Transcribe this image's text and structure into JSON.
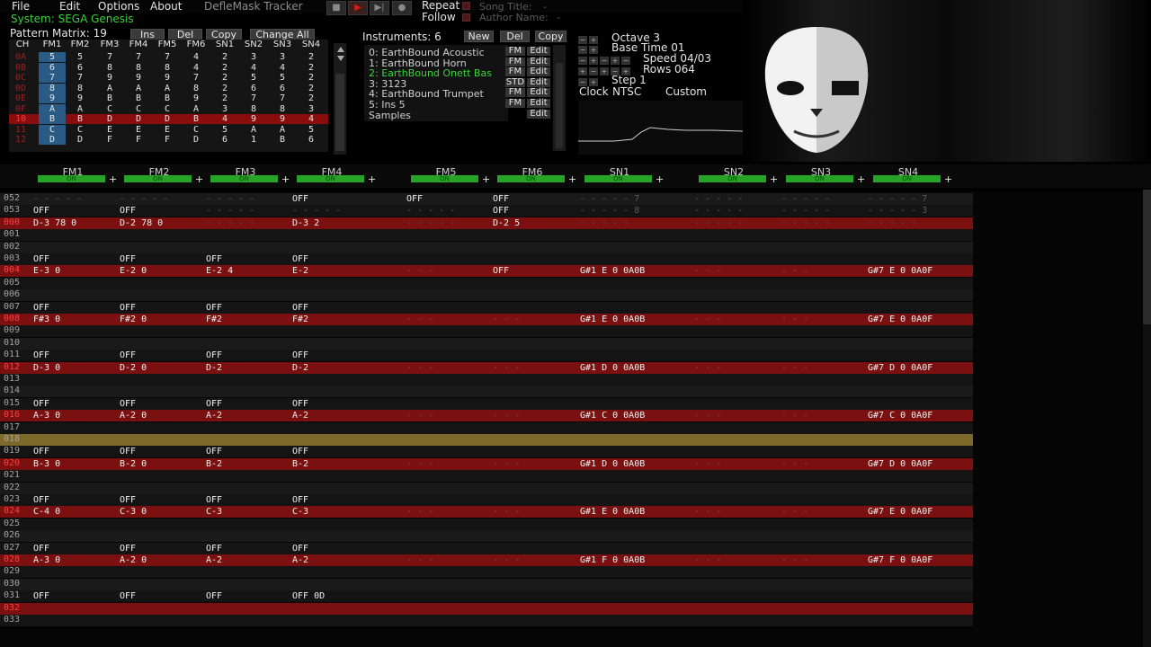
{
  "menu": {
    "items": [
      "File",
      "Edit",
      "Options",
      "About"
    ],
    "app_title": "DefleMask Tracker"
  },
  "transport": {
    "stop": "■",
    "play": "▶",
    "next": "▶|",
    "record": "●",
    "repeat_label": "Repeat",
    "follow_label": "Follow",
    "song_title_label": "Song Title:",
    "author_label": "Author Name:",
    "song_title_value": "-",
    "author_value": "-"
  },
  "system": {
    "label": "System: SEGA Genesis"
  },
  "pattern_matrix": {
    "label": "Pattern Matrix: 19",
    "buttons": [
      "Ins",
      "Del",
      "Copy",
      "Change All"
    ],
    "headers": [
      "CH",
      "FM1",
      "FM2",
      "FM3",
      "FM4",
      "FM5",
      "FM6",
      "SN1",
      "SN2",
      "SN3",
      "SN4"
    ],
    "rows": [
      [
        "0A",
        "5",
        "5",
        "7",
        "7",
        "7",
        "4",
        "2",
        "3",
        "3",
        "2"
      ],
      [
        "0B",
        "6",
        "6",
        "8",
        "8",
        "8",
        "4",
        "2",
        "4",
        "4",
        "2"
      ],
      [
        "0C",
        "7",
        "7",
        "9",
        "9",
        "9",
        "7",
        "2",
        "5",
        "5",
        "2"
      ],
      [
        "0D",
        "8",
        "8",
        "A",
        "A",
        "A",
        "8",
        "2",
        "6",
        "6",
        "2"
      ],
      [
        "0E",
        "9",
        "9",
        "B",
        "B",
        "B",
        "9",
        "2",
        "7",
        "7",
        "2"
      ],
      [
        "0F",
        "A",
        "A",
        "C",
        "C",
        "C",
        "A",
        "3",
        "8",
        "8",
        "3"
      ],
      [
        "10",
        "B",
        "B",
        "D",
        "D",
        "D",
        "B",
        "4",
        "9",
        "9",
        "4"
      ],
      [
        "11",
        "C",
        "C",
        "E",
        "E",
        "E",
        "C",
        "5",
        "A",
        "A",
        "5"
      ],
      [
        "12",
        "D",
        "D",
        "F",
        "F",
        "F",
        "D",
        "6",
        "1",
        "B",
        "6"
      ]
    ],
    "current_row": 6
  },
  "instruments": {
    "label": "Instruments: 6",
    "buttons": [
      "New",
      "Del",
      "Copy"
    ],
    "items": [
      {
        "name": "0: EarthBound Acoustic",
        "type": "FM"
      },
      {
        "name": "1: EarthBound Horn",
        "type": "FM"
      },
      {
        "name": "2: EarthBound Onett Bas",
        "type": "FM"
      },
      {
        "name": "3: 3123",
        "type": "STD"
      },
      {
        "name": "4: EarthBound Trumpet",
        "type": "FM"
      },
      {
        "name": "5: Ins 5",
        "type": "FM"
      },
      {
        "name": "Samples",
        "type": ""
      }
    ],
    "selected": 2,
    "edit_label": "Edit"
  },
  "settings": {
    "octave": "Octave 3",
    "base_time": "Base Time 01",
    "speed": "Speed 04/03",
    "rows": "Rows 064",
    "step": "Step 1",
    "clock_label": "Clock",
    "clock_value": "NTSC",
    "custom_label": "Custom"
  },
  "channels": [
    "FM1",
    "FM2",
    "FM3",
    "FM4",
    "FM5",
    "FM6",
    "SN1",
    "SN2",
    "SN3",
    "SN4"
  ],
  "channel_toggle": "ON",
  "pattern": {
    "rows": [
      {
        "n": "052",
        "c": [
          "- - -  - -",
          "- - -  - -",
          "- - -  - -",
          "OFF",
          "OFF",
          "OFF",
          "- - -  - -  7",
          "- - -  - -",
          "- - -  - -",
          "- - -  - -  7"
        ]
      },
      {
        "n": "053",
        "c": [
          "OFF",
          "OFF",
          "- - -  - -",
          "- - -  - -",
          "- - -  - -",
          "OFF",
          "- - -  - -  8",
          "- - -  - -",
          "- - -  - -",
          "- - -  - -  3"
        ]
      },
      {
        "n": "000",
        "c": [
          "D-3 78  0",
          "D-2 78  0",
          "- - -  - -",
          "D-3  2",
          "- - -  - -",
          "D-2  5",
          "- - -  - -",
          "- - -  - -",
          "- - -  - -",
          "- - -  - -"
        ]
      },
      {
        "n": "001",
        "c": [
          "",
          "",
          "",
          "",
          "",
          "",
          "",
          "",
          "",
          ""
        ]
      },
      {
        "n": "002",
        "c": [
          "",
          "",
          "",
          "",
          "",
          "",
          "",
          "",
          "",
          ""
        ]
      },
      {
        "n": "003",
        "c": [
          "OFF",
          "OFF",
          "OFF",
          "OFF",
          "",
          "",
          "",
          "",
          "",
          ""
        ]
      },
      {
        "n": "004",
        "c": [
          "E-3  0",
          "E-2  0",
          "E-2  4",
          "E-2",
          "- - -",
          "OFF",
          "G#1 E  0 0A0B",
          "- - -",
          "- - -",
          "G#7 E  0 0A0F"
        ]
      },
      {
        "n": "005",
        "c": [
          "",
          "",
          "",
          "",
          "",
          "",
          "",
          "",
          "",
          ""
        ]
      },
      {
        "n": "006",
        "c": [
          "",
          "",
          "",
          "",
          "",
          "",
          "",
          "",
          "",
          ""
        ]
      },
      {
        "n": "007",
        "c": [
          "OFF",
          "OFF",
          "OFF",
          "OFF",
          "",
          "",
          "",
          "",
          "",
          ""
        ]
      },
      {
        "n": "008",
        "c": [
          "F#3  0",
          "F#2  0",
          "F#2",
          "F#2",
          "- - -",
          "- - -",
          "G#1 E  0 0A0B",
          "- - -",
          "- - -",
          "G#7 E  0 0A0F"
        ]
      },
      {
        "n": "009",
        "c": [
          "",
          "",
          "",
          "",
          "",
          "",
          "",
          "",
          "",
          ""
        ]
      },
      {
        "n": "010",
        "c": [
          "",
          "",
          "",
          "",
          "",
          "",
          "",
          "",
          "",
          ""
        ]
      },
      {
        "n": "011",
        "c": [
          "OFF",
          "OFF",
          "OFF",
          "OFF",
          "",
          "",
          "",
          "",
          "",
          ""
        ]
      },
      {
        "n": "012",
        "c": [
          "D-3  0",
          "D-2  0",
          "D-2",
          "D-2",
          "- - -",
          "- - -",
          "G#1 D  0 0A0B",
          "- - -",
          "- - -",
          "G#7 D  0 0A0F"
        ]
      },
      {
        "n": "013",
        "c": [
          "",
          "",
          "",
          "",
          "",
          "",
          "",
          "",
          "",
          ""
        ]
      },
      {
        "n": "014",
        "c": [
          "",
          "",
          "",
          "",
          "",
          "",
          "",
          "",
          "",
          ""
        ]
      },
      {
        "n": "015",
        "c": [
          "OFF",
          "OFF",
          "OFF",
          "OFF",
          "",
          "",
          "",
          "",
          "",
          ""
        ]
      },
      {
        "n": "016",
        "c": [
          "A-3  0",
          "A-2  0",
          "A-2",
          "A-2",
          "- - -",
          "- - -",
          "G#1 C  0 0A0B",
          "- - -",
          "- - -",
          "G#7 C  0 0A0F"
        ]
      },
      {
        "n": "017",
        "c": [
          "",
          "",
          "",
          "",
          "",
          "",
          "",
          "",
          "",
          ""
        ]
      },
      {
        "n": "018",
        "c": [
          "",
          "",
          "",
          "",
          "",
          "",
          "",
          "",
          "",
          ""
        ]
      },
      {
        "n": "019",
        "c": [
          "OFF",
          "OFF",
          "OFF",
          "OFF",
          "",
          "",
          "",
          "",
          "",
          ""
        ]
      },
      {
        "n": "020",
        "c": [
          "B-3  0",
          "B-2  0",
          "B-2",
          "B-2",
          "- - -",
          "- - -",
          "G#1 D  0 0A0B",
          "- - -",
          "- - -",
          "G#7 D  0 0A0F"
        ]
      },
      {
        "n": "021",
        "c": [
          "",
          "",
          "",
          "",
          "",
          "",
          "",
          "",
          "",
          ""
        ]
      },
      {
        "n": "022",
        "c": [
          "",
          "",
          "",
          "",
          "",
          "",
          "",
          "",
          "",
          ""
        ]
      },
      {
        "n": "023",
        "c": [
          "OFF",
          "OFF",
          "OFF",
          "OFF",
          "",
          "",
          "",
          "",
          "",
          ""
        ]
      },
      {
        "n": "024",
        "c": [
          "C-4  0",
          "C-3  0",
          "C-3",
          "C-3",
          "- - -",
          "- - -",
          "G#1 E  0 0A0B",
          "- - -",
          "- - -",
          "G#7 E  0 0A0F"
        ]
      },
      {
        "n": "025",
        "c": [
          "",
          "",
          "",
          "",
          "",
          "",
          "",
          "",
          "",
          ""
        ]
      },
      {
        "n": "026",
        "c": [
          "",
          "",
          "",
          "",
          "",
          "",
          "",
          "",
          "",
          ""
        ]
      },
      {
        "n": "027",
        "c": [
          "OFF",
          "OFF",
          "OFF",
          "OFF",
          "",
          "",
          "",
          "",
          "",
          ""
        ]
      },
      {
        "n": "028",
        "c": [
          "A-3  0",
          "A-2  0",
          "A-2",
          "A-2",
          "- - -",
          "- - -",
          "G#1 F  0 0A0B",
          "- - -",
          "- - -",
          "G#7 F  0 0A0F"
        ]
      },
      {
        "n": "029",
        "c": [
          "",
          "",
          "",
          "",
          "",
          "",
          "",
          "",
          "",
          ""
        ]
      },
      {
        "n": "030",
        "c": [
          "",
          "",
          "",
          "",
          "",
          "",
          "",
          "",
          "",
          ""
        ]
      },
      {
        "n": "031",
        "c": [
          "OFF",
          "OFF",
          "OFF",
          "OFF  0D",
          "",
          "",
          "",
          "",
          "",
          ""
        ]
      },
      {
        "n": "032",
        "c": [
          "",
          "",
          "",
          "",
          "",
          "",
          "",
          "",
          "",
          ""
        ]
      },
      {
        "n": "033",
        "c": [
          "",
          "",
          "",
          "",
          "",
          "",
          "",
          "",
          "",
          ""
        ]
      }
    ],
    "beat_rows": [
      2,
      6,
      10,
      14,
      18,
      22,
      26,
      30,
      34
    ],
    "cursor_row": 20
  }
}
